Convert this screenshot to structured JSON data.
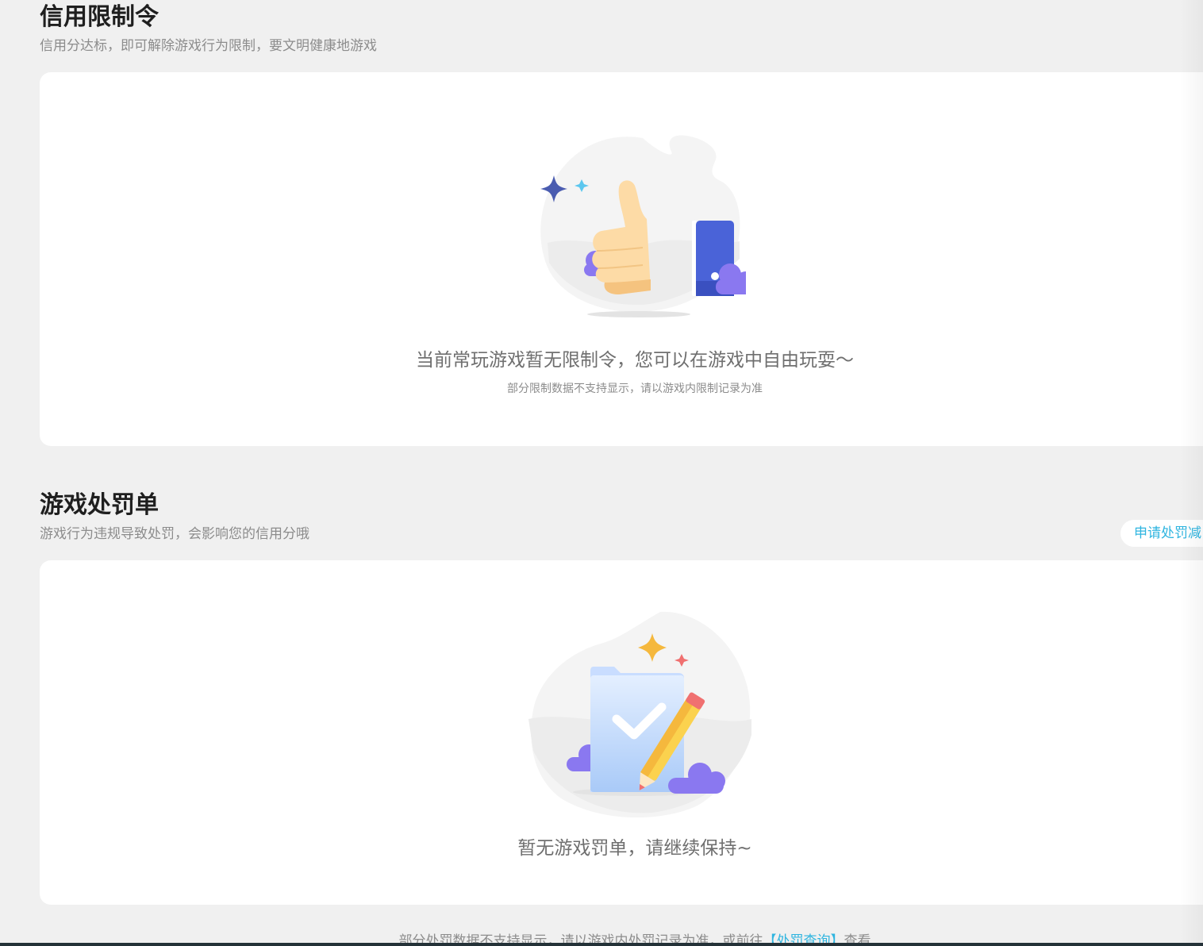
{
  "restriction": {
    "title": "信用限制令",
    "subtitle": "信用分达标，即可解除游戏行为限制，要文明健康地游戏",
    "empty_title": "当前常玩游戏暂无限制令，您可以在游戏中自由玩耍～",
    "empty_note": "部分限制数据不支持显示，请以游戏内限制记录为准",
    "illustration": "thumbs-up-illustration"
  },
  "penalty": {
    "title": "游戏处罚单",
    "subtitle": "游戏行为违规导致处罚，会影响您的信用分哦",
    "appeal_button": "申请处罚减",
    "empty_title": "暂无游戏罚单，请继续保持~",
    "illustration": "checklist-pencil-illustration"
  },
  "footer": {
    "prefix": "部分处罚数据不支持显示，请以游戏内处罚记录为准，或前往",
    "link": "【处罚查询】",
    "suffix": "查看"
  },
  "colors": {
    "accent": "#2fb5e0",
    "thumb_cuff": "#4a63d8",
    "cloud": "#8a78f0",
    "sparkle_dark": "#4a5cb0",
    "sparkle_light": "#5cc7ef",
    "sparkle_yellow": "#f5b83d",
    "sparkle_red": "#f07070"
  }
}
